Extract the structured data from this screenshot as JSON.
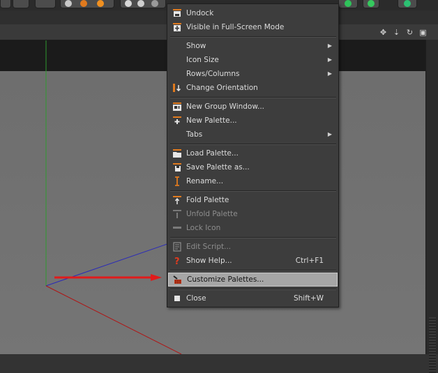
{
  "menu": {
    "items": [
      {
        "label": "Undock",
        "icon": "undock-icon"
      },
      {
        "label": "Visible in Full-Screen Mode",
        "icon": "fullscreen-icon"
      },
      {
        "label": "Show",
        "submenu": true
      },
      {
        "label": "Icon Size",
        "submenu": true
      },
      {
        "label": "Rows/Columns",
        "submenu": true
      },
      {
        "label": "Change Orientation",
        "icon": "orientation-icon"
      },
      {
        "label": "New Group Window...",
        "icon": "group-window-icon"
      },
      {
        "label": "New Palette...",
        "icon": "new-palette-icon"
      },
      {
        "label": "Tabs",
        "submenu": true
      },
      {
        "label": "Load Palette...",
        "icon": "folder-icon"
      },
      {
        "label": "Save Palette as...",
        "icon": "save-palette-icon"
      },
      {
        "label": "Rename...",
        "icon": "rename-icon"
      },
      {
        "label": "Fold Palette",
        "icon": "fold-icon"
      },
      {
        "label": "Unfold Palette",
        "icon": "unfold-icon",
        "disabled": true
      },
      {
        "label": "Lock Icon",
        "icon": "lock-icon-palette",
        "disabled": true
      },
      {
        "label": "Edit Script...",
        "icon": "script-icon",
        "disabled": true
      },
      {
        "label": "Show Help...",
        "icon": "help-icon",
        "shortcut": "Ctrl+F1"
      },
      {
        "label": "Customize Palettes...",
        "icon": "customize-icon",
        "highlighted": true
      },
      {
        "label": "Close",
        "icon": "close-square-icon",
        "shortcut": "Shift+W"
      }
    ]
  },
  "nav_icons": [
    "move-icon",
    "down-arrows-icon",
    "rotate-icon",
    "maximize-icon"
  ],
  "colors": {
    "menu_bg": "#3d3d3d",
    "highlight": "#a6a6a6",
    "arrow": "#e01b1b",
    "axis_x": "#b01515",
    "axis_y": "#2f9a2f",
    "axis_z": "#2a2ab8"
  }
}
